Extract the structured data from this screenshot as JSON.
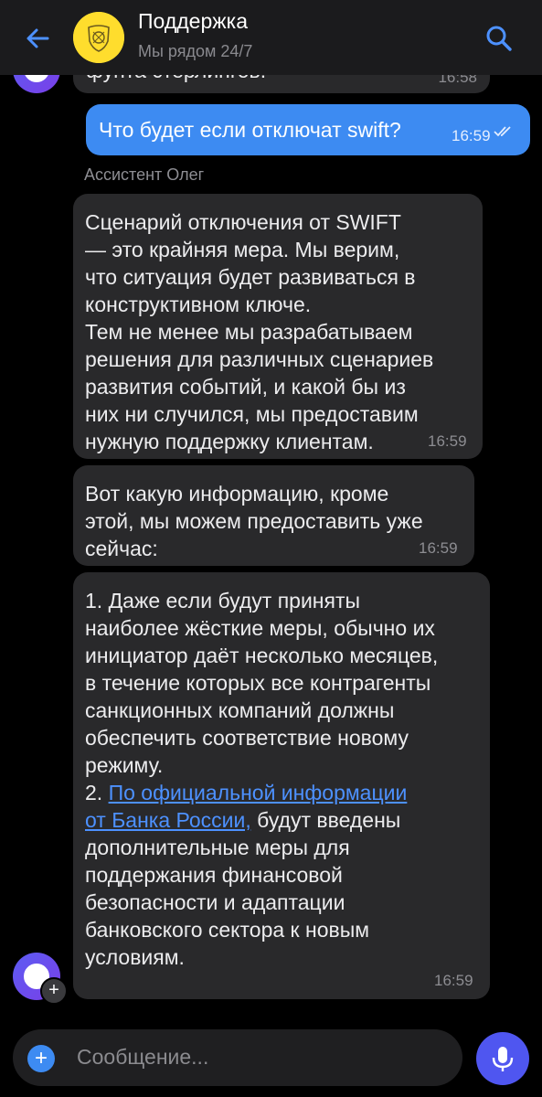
{
  "header": {
    "title": "Поддержка",
    "subtitle": "Мы рядом 24/7",
    "back_icon": "arrow-left-icon",
    "search_icon": "search-icon",
    "logo": "tinkoff-bank-logo"
  },
  "messages": {
    "clipped": {
      "text": "фунта стерлингов.",
      "time": "16:58"
    },
    "outgoing": {
      "text": "Что будет если отключат swift?",
      "time": "16:59",
      "status": "read"
    },
    "sender_name": "Ассистент Олег",
    "m1": {
      "text": "Сценарий отключения от SWIFT\n— это крайняя мера. Мы верим,\nчто ситуация будет развиваться в\nконструктивном ключе.\nТем не менее мы разрабатываем\nрешения для различных сценариев\nразвития событий, и какой бы из\nних ни случился, мы предоставим\nнужную поддержку клиентам.",
      "time": "16:59"
    },
    "m2": {
      "text": "Вот какую информацию, кроме\nэтой, мы можем предоставить уже\nсейчас:",
      "time": "16:59"
    },
    "m3": {
      "part1": "1. Даже если будут приняты\nнаиболее жёсткие меры, обычно их\nинициатор даёт несколько месяцев,\nв течение которых все контрагенты\nсанкционных компаний должны\nобеспечить соответствие новому\nрежиму.\n2. ",
      "link": "По официальной информации\nот Банка России,",
      "part2": " будут введены\nдополнительные меры для\nподдержания финансовой\nбезопасности и адаптации\nбанковского сектора к новым\nусловиям.",
      "time": "16:59"
    }
  },
  "input": {
    "placeholder": "Сообщение...",
    "attach_icon": "plus-icon",
    "mic_icon": "microphone-icon"
  },
  "colors": {
    "accent": "#3d8bf2",
    "bubble_incoming": "#29292b",
    "link": "#4d91ff",
    "mic_button": "#4f56f0"
  }
}
